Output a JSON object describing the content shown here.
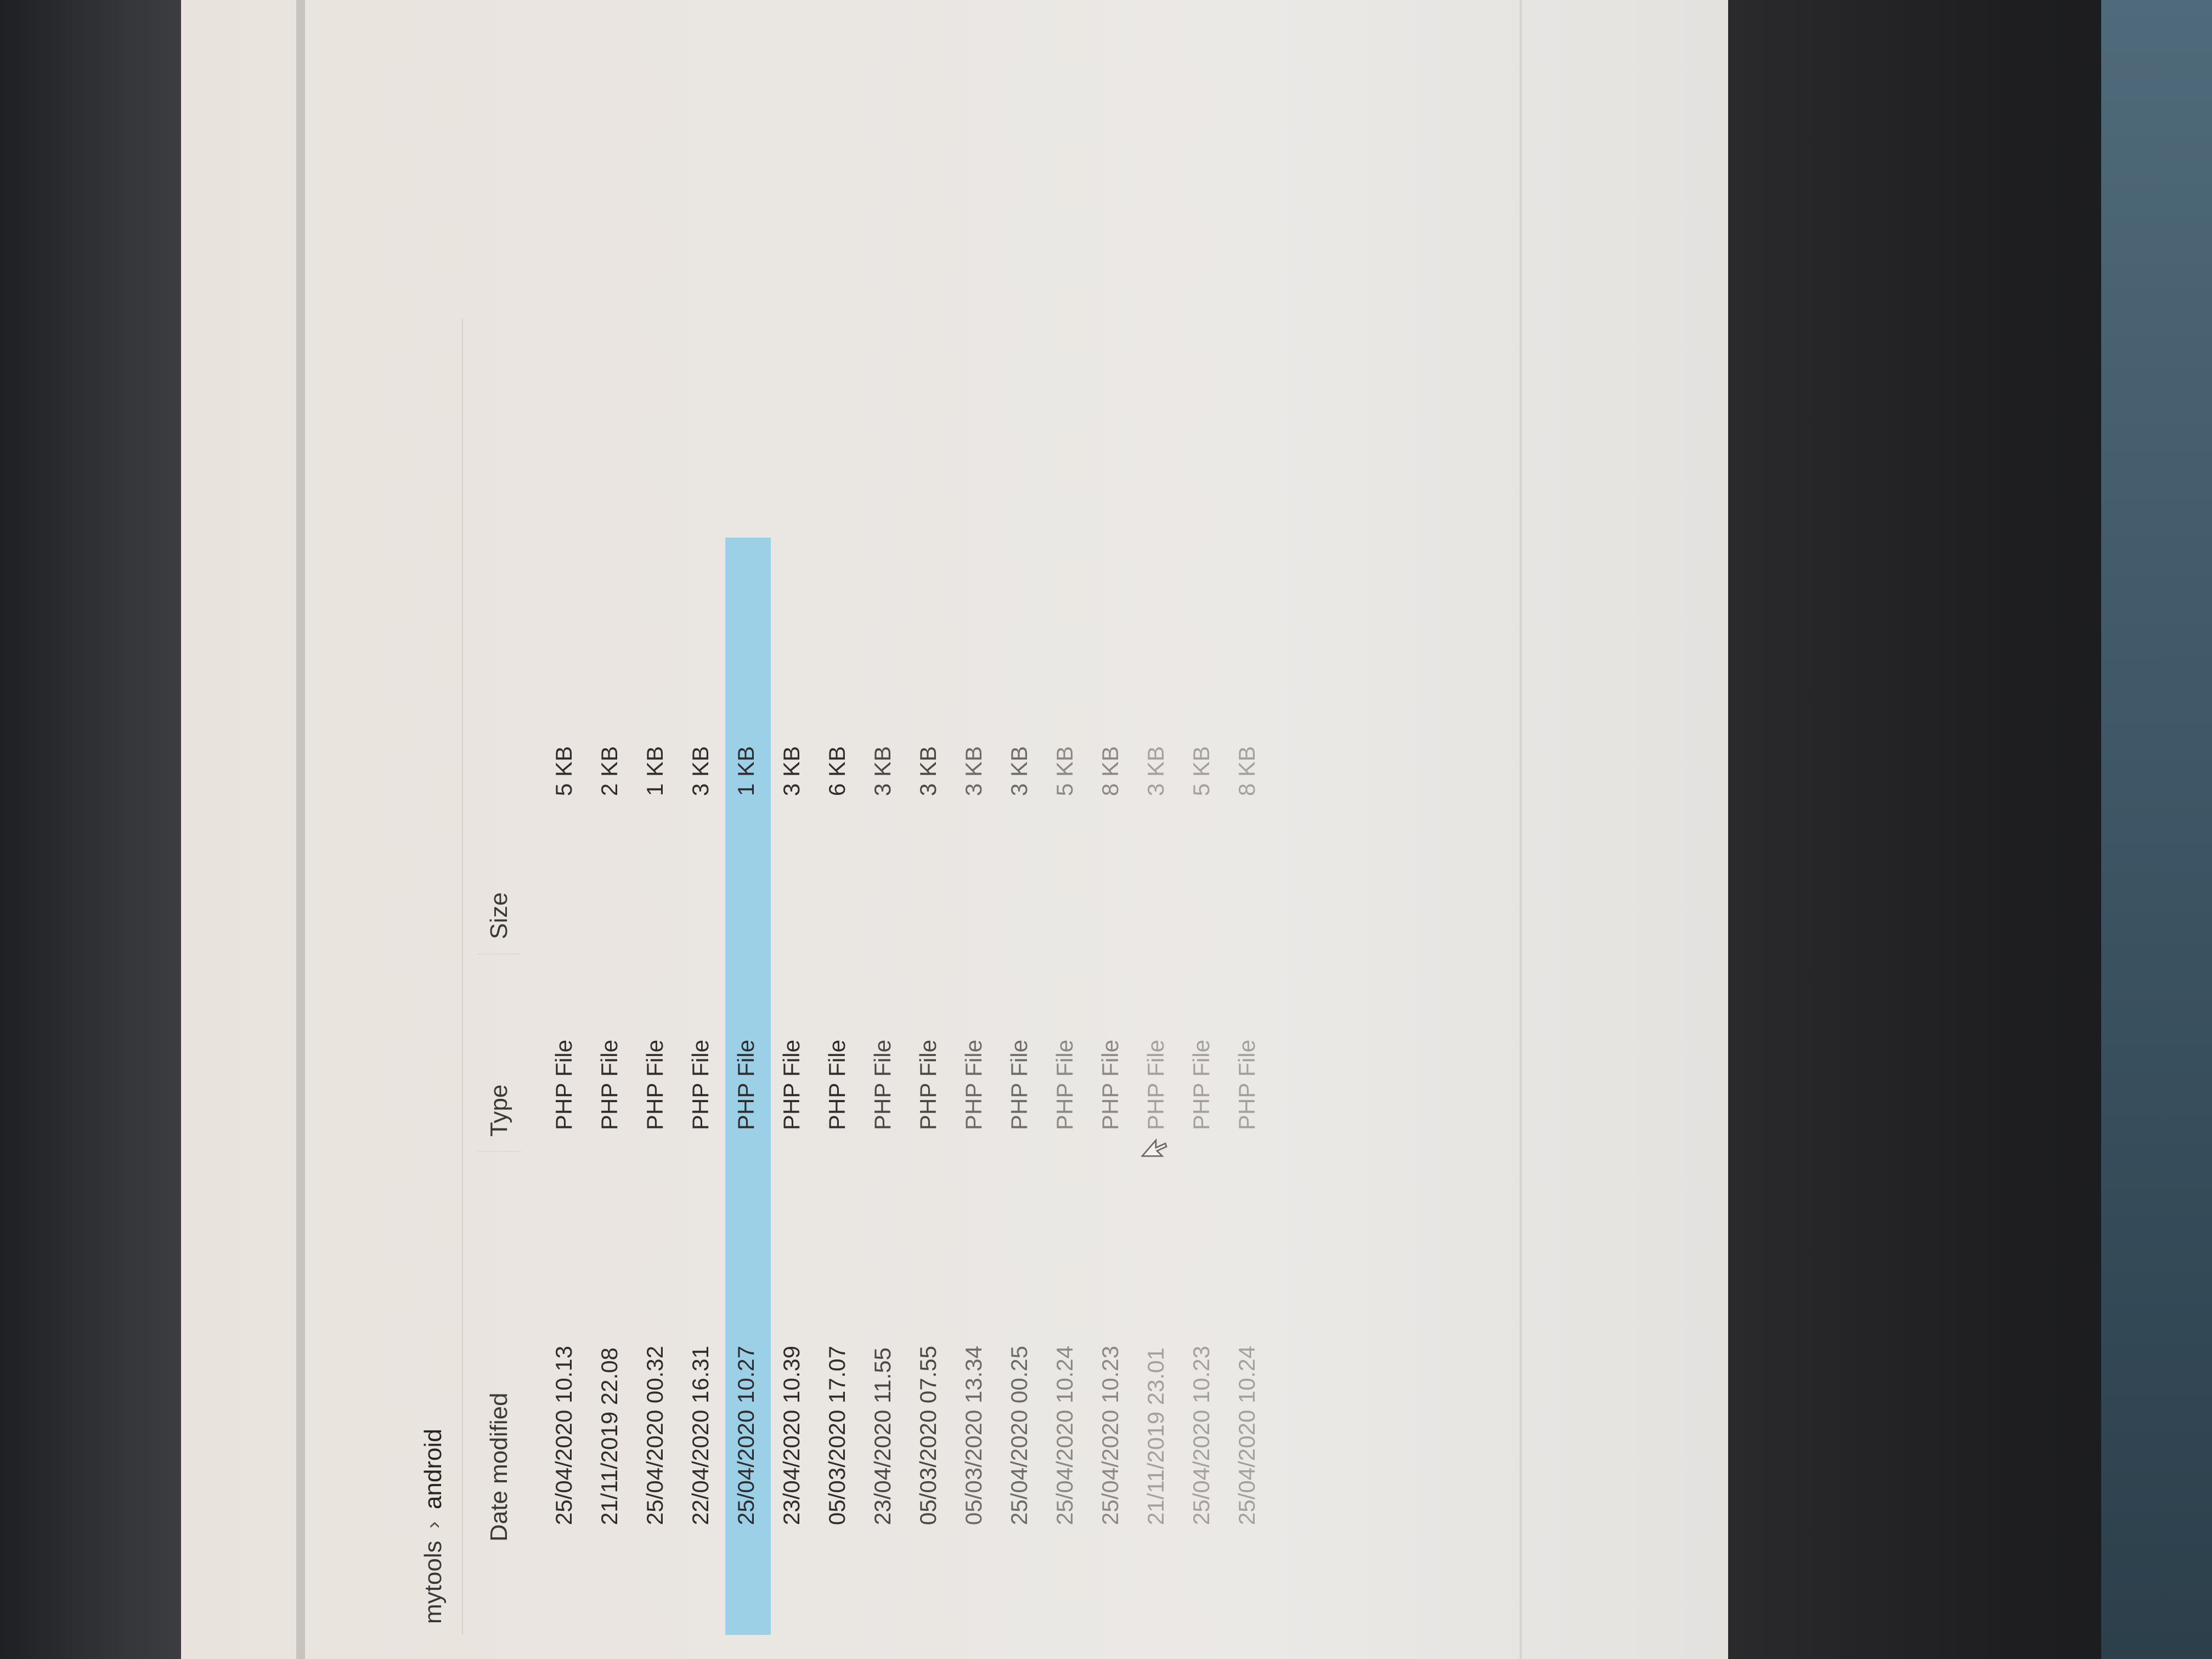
{
  "breadcrumb": {
    "parent": "mytools",
    "separator": "›",
    "current": "android"
  },
  "columns": {
    "date": "Date modified",
    "type": "Type",
    "size": "Size"
  },
  "files": [
    {
      "date": "25/04/2020 10.13",
      "type": "PHP File",
      "size": "5 KB",
      "selected": false
    },
    {
      "date": "21/11/2019 22.08",
      "type": "PHP File",
      "size": "2 KB",
      "selected": false
    },
    {
      "date": "25/04/2020 00.32",
      "type": "PHP File",
      "size": "1 KB",
      "selected": false
    },
    {
      "date": "22/04/2020 16.31",
      "type": "PHP File",
      "size": "3 KB",
      "selected": false
    },
    {
      "date": "25/04/2020 10.27",
      "type": "PHP File",
      "size": "1 KB",
      "selected": true
    },
    {
      "date": "23/04/2020 10.39",
      "type": "PHP File",
      "size": "3 KB",
      "selected": false
    },
    {
      "date": "05/03/2020 17.07",
      "type": "PHP File",
      "size": "6 KB",
      "selected": false
    },
    {
      "date": "23/04/2020 11.55",
      "type": "PHP File",
      "size": "3 KB",
      "selected": false
    },
    {
      "date": "05/03/2020 07.55",
      "type": "PHP File",
      "size": "3 KB",
      "selected": false
    },
    {
      "date": "05/03/2020 13.34",
      "type": "PHP File",
      "size": "3 KB",
      "selected": false
    },
    {
      "date": "25/04/2020 00.25",
      "type": "PHP File",
      "size": "3 KB",
      "selected": false
    },
    {
      "date": "25/04/2020 10.24",
      "type": "PHP File",
      "size": "5 KB",
      "selected": false
    },
    {
      "date": "25/04/2020 10.23",
      "type": "PHP File",
      "size": "8 KB",
      "selected": false
    },
    {
      "date": "21/11/2019 23.01",
      "type": "PHP File",
      "size": "3 KB",
      "selected": false
    },
    {
      "date": "25/04/2020 10.23",
      "type": "PHP File",
      "size": "5 KB",
      "selected": false
    },
    {
      "date": "25/04/2020 10.24",
      "type": "PHP File",
      "size": "8 KB",
      "selected": false
    }
  ],
  "colors": {
    "selection": "#9cd0e6",
    "screen": "#ebe8e4"
  }
}
